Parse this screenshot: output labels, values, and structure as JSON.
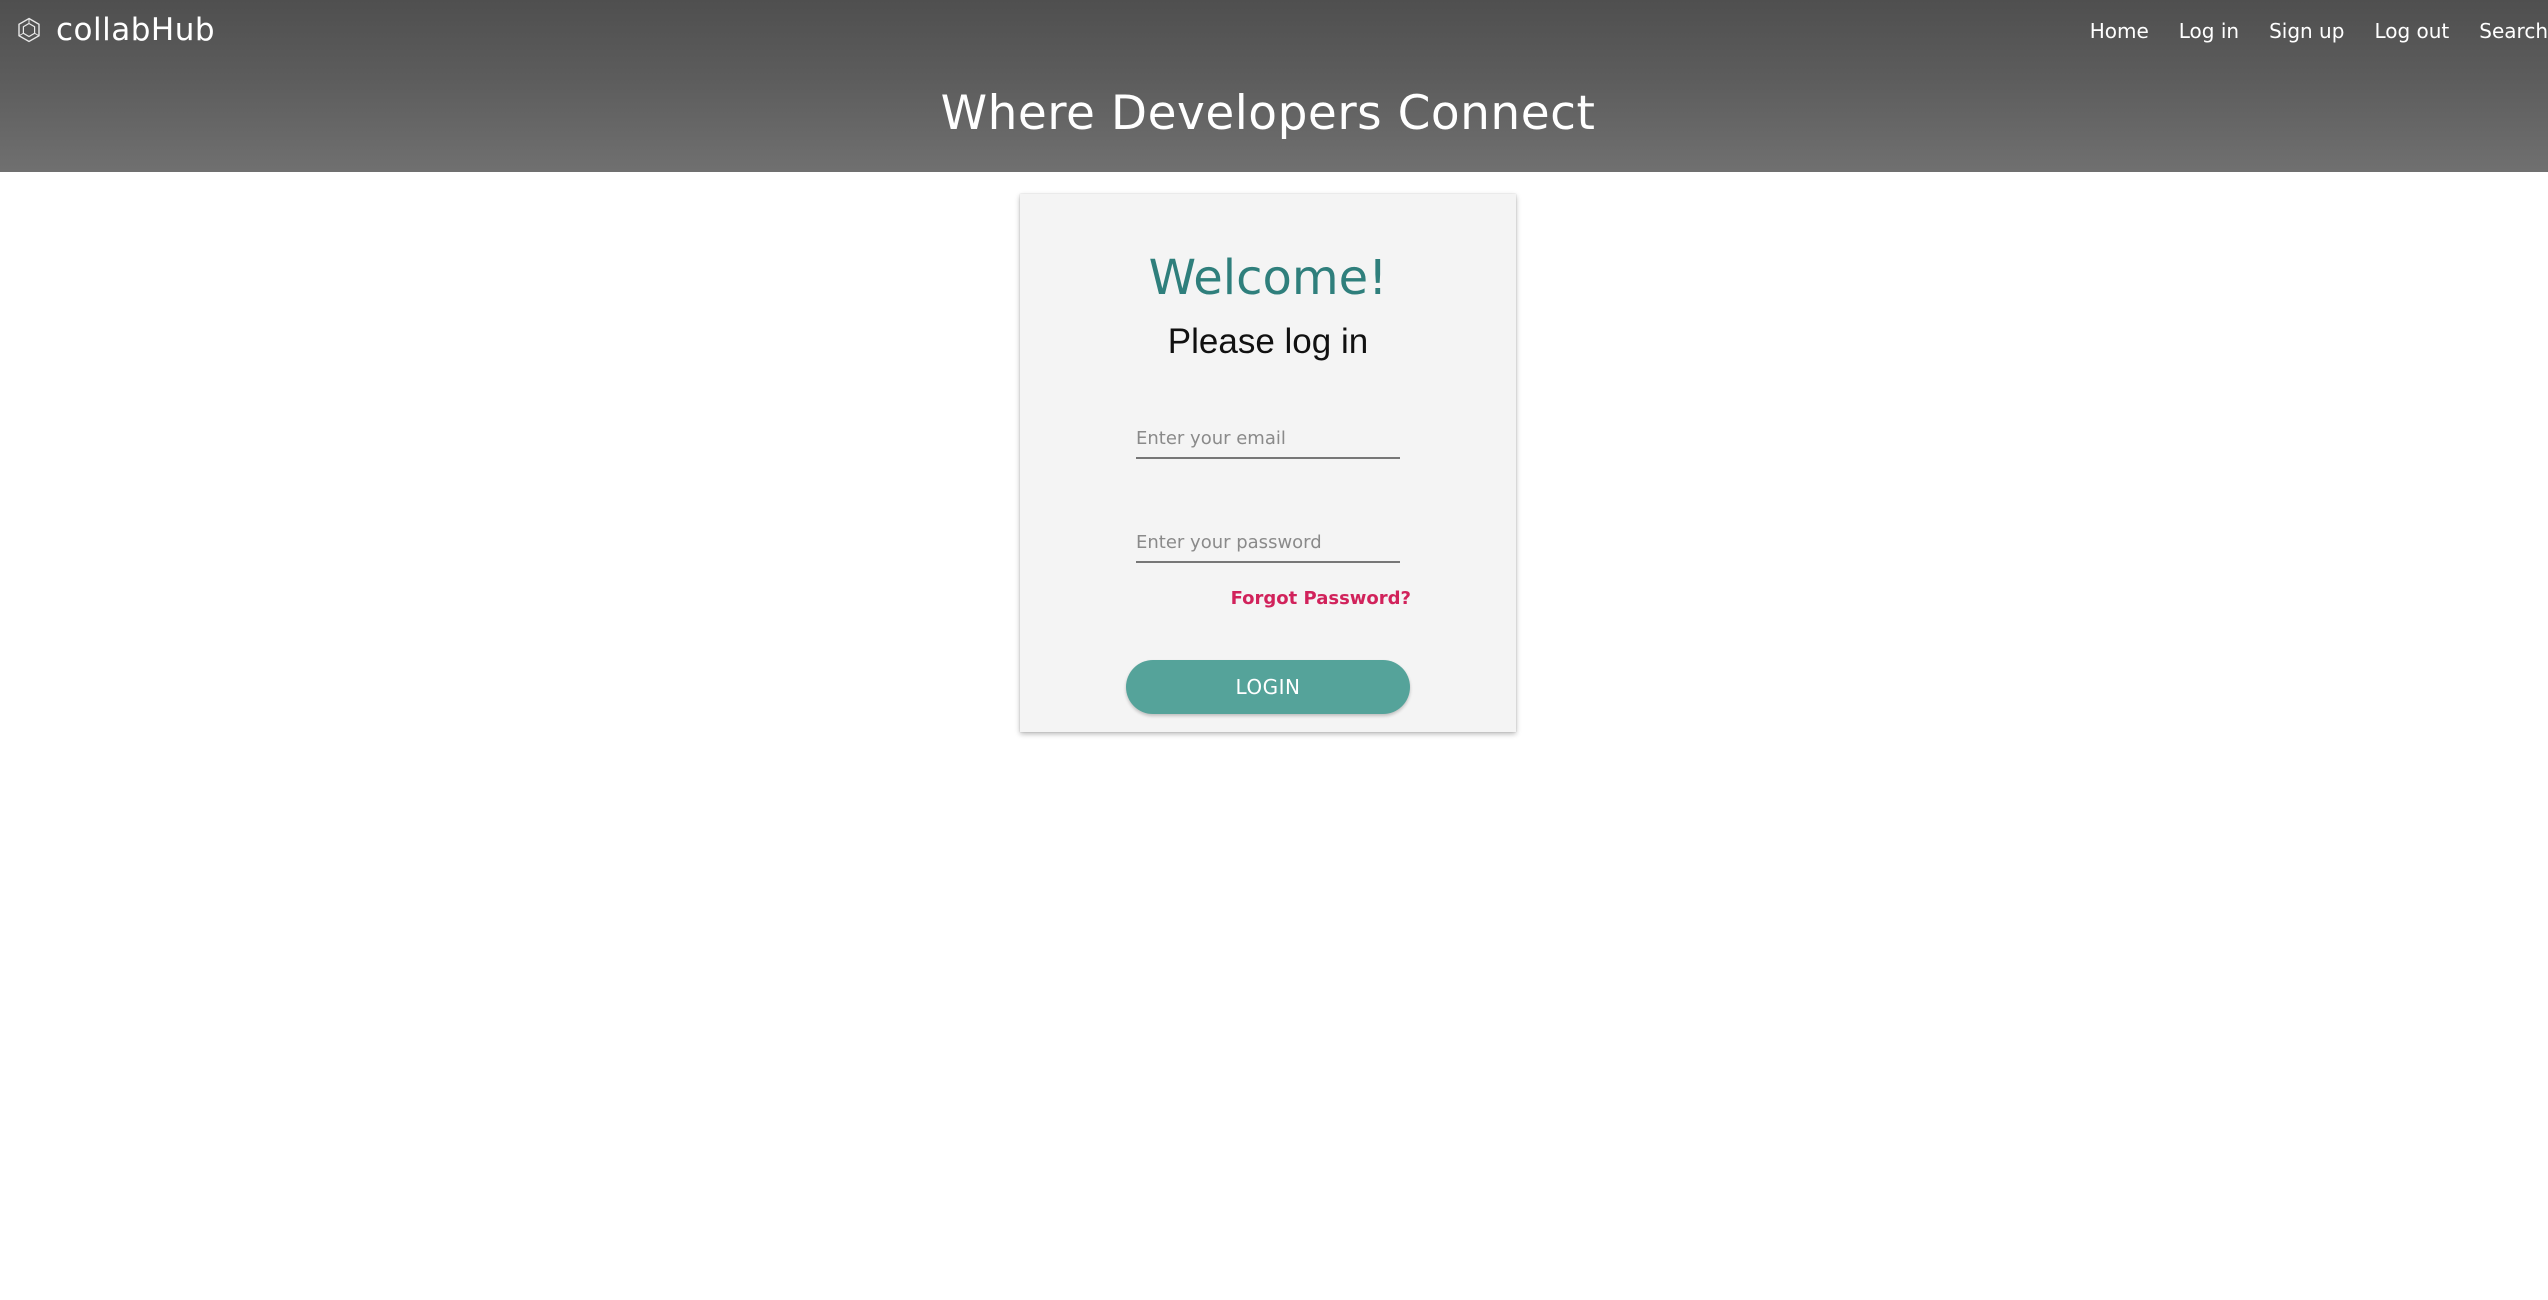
{
  "brand": {
    "name": "collabHub",
    "icon": "hexagon-logo-icon"
  },
  "nav": {
    "items": [
      {
        "label": "Home"
      },
      {
        "label": "Log in"
      },
      {
        "label": "Sign up"
      },
      {
        "label": "Log out"
      },
      {
        "label": "Search"
      }
    ]
  },
  "header": {
    "tagline": "Where Developers Connect"
  },
  "login_card": {
    "title": "Welcome!",
    "subtitle": "Please log in",
    "email": {
      "value": "",
      "placeholder": "Enter your email"
    },
    "password": {
      "value": "",
      "placeholder": "Enter your password"
    },
    "forgot_label": "Forgot Password?",
    "login_label": "LOGIN"
  },
  "colors": {
    "header_top": "#4f4f4f",
    "header_bottom": "#707070",
    "title_teal": "#2f7f7c",
    "button_teal": "#55a39a",
    "forgot_pink": "#d1225b",
    "card_bg": "#f4f4f4"
  }
}
